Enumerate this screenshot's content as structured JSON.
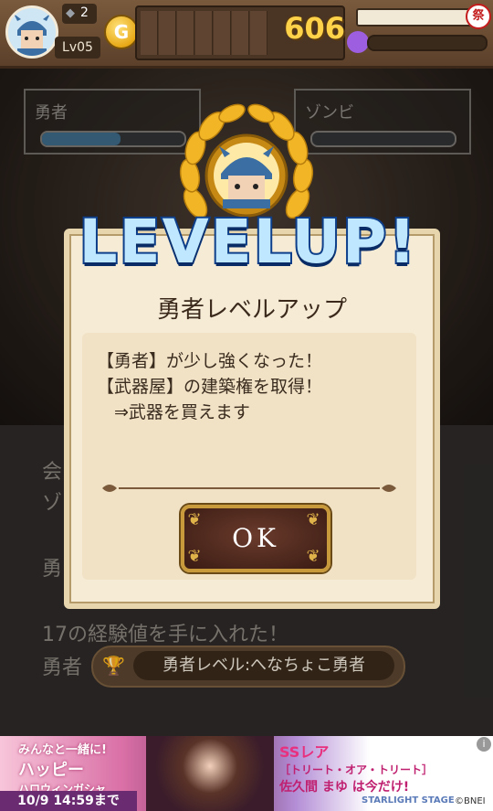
{
  "topbar": {
    "gems": "2",
    "level": "Lv05",
    "coin_symbol": "G",
    "coins": "606",
    "festival_icon": "祭"
  },
  "units": {
    "hero": {
      "name": "勇者",
      "hp_fraction": 0.55
    },
    "enemy": {
      "name": "ゾンビ",
      "hp_fraction": 0.0
    }
  },
  "log": {
    "lines_partial": [
      "会",
      "ゾ",
      "勇"
    ],
    "exp_line": "17の経験値を手に入れた！",
    "hero_label": "勇者",
    "rank_label": "勇者レベル:へなちょこ勇者"
  },
  "levelup": {
    "banner": "LEVELUP!",
    "title": "勇者レベルアップ",
    "messages": [
      "【勇者】が少し強くなった！",
      "【武器屋】の建築権を取得！",
      "　⇒武器を買えます"
    ],
    "ok_label": "OK"
  },
  "ad": {
    "left_line1": "みんなと一緒に!",
    "left_line2": "ハッピー",
    "left_line3": "ハロウィンガシャ",
    "date": "10/9 14:59まで",
    "right_line1": "SSレア",
    "right_line2": "［トリート・オア・トリート］",
    "right_line3": "佐久間 まゆ は今だけ!",
    "brand": "STARLIGHT STAGE",
    "copyright": "©BNEI",
    "info": "i"
  },
  "colors": {
    "gold": "#ffd24a",
    "bar_blue": "#3c6a86",
    "dialog_bg": "#f6ecd6",
    "levelup_blue": "#bfe7ff"
  }
}
